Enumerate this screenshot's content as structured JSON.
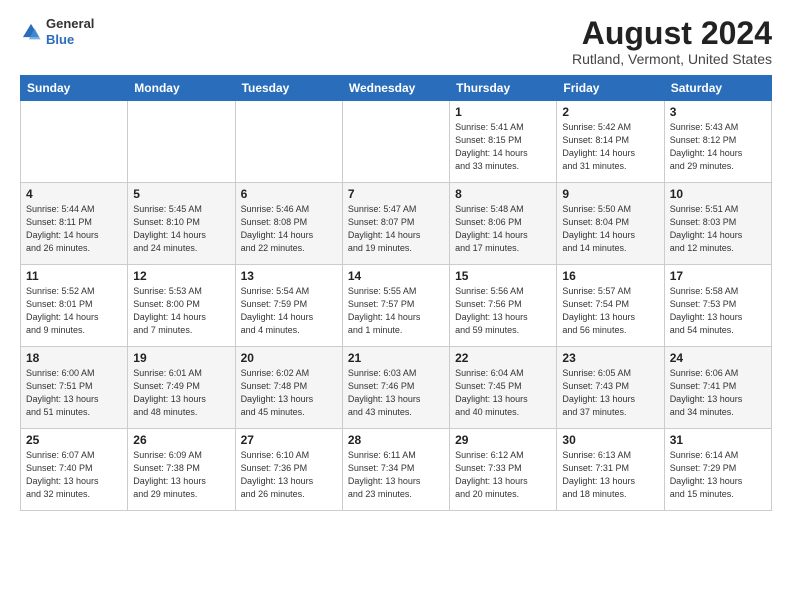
{
  "header": {
    "logo": {
      "general": "General",
      "blue": "Blue"
    },
    "title": "August 2024",
    "location": "Rutland, Vermont, United States"
  },
  "weekdays": [
    "Sunday",
    "Monday",
    "Tuesday",
    "Wednesday",
    "Thursday",
    "Friday",
    "Saturday"
  ],
  "weeks": [
    [
      {
        "day": "",
        "info": ""
      },
      {
        "day": "",
        "info": ""
      },
      {
        "day": "",
        "info": ""
      },
      {
        "day": "",
        "info": ""
      },
      {
        "day": "1",
        "info": "Sunrise: 5:41 AM\nSunset: 8:15 PM\nDaylight: 14 hours\nand 33 minutes."
      },
      {
        "day": "2",
        "info": "Sunrise: 5:42 AM\nSunset: 8:14 PM\nDaylight: 14 hours\nand 31 minutes."
      },
      {
        "day": "3",
        "info": "Sunrise: 5:43 AM\nSunset: 8:12 PM\nDaylight: 14 hours\nand 29 minutes."
      }
    ],
    [
      {
        "day": "4",
        "info": "Sunrise: 5:44 AM\nSunset: 8:11 PM\nDaylight: 14 hours\nand 26 minutes."
      },
      {
        "day": "5",
        "info": "Sunrise: 5:45 AM\nSunset: 8:10 PM\nDaylight: 14 hours\nand 24 minutes."
      },
      {
        "day": "6",
        "info": "Sunrise: 5:46 AM\nSunset: 8:08 PM\nDaylight: 14 hours\nand 22 minutes."
      },
      {
        "day": "7",
        "info": "Sunrise: 5:47 AM\nSunset: 8:07 PM\nDaylight: 14 hours\nand 19 minutes."
      },
      {
        "day": "8",
        "info": "Sunrise: 5:48 AM\nSunset: 8:06 PM\nDaylight: 14 hours\nand 17 minutes."
      },
      {
        "day": "9",
        "info": "Sunrise: 5:50 AM\nSunset: 8:04 PM\nDaylight: 14 hours\nand 14 minutes."
      },
      {
        "day": "10",
        "info": "Sunrise: 5:51 AM\nSunset: 8:03 PM\nDaylight: 14 hours\nand 12 minutes."
      }
    ],
    [
      {
        "day": "11",
        "info": "Sunrise: 5:52 AM\nSunset: 8:01 PM\nDaylight: 14 hours\nand 9 minutes."
      },
      {
        "day": "12",
        "info": "Sunrise: 5:53 AM\nSunset: 8:00 PM\nDaylight: 14 hours\nand 7 minutes."
      },
      {
        "day": "13",
        "info": "Sunrise: 5:54 AM\nSunset: 7:59 PM\nDaylight: 14 hours\nand 4 minutes."
      },
      {
        "day": "14",
        "info": "Sunrise: 5:55 AM\nSunset: 7:57 PM\nDaylight: 14 hours\nand 1 minute."
      },
      {
        "day": "15",
        "info": "Sunrise: 5:56 AM\nSunset: 7:56 PM\nDaylight: 13 hours\nand 59 minutes."
      },
      {
        "day": "16",
        "info": "Sunrise: 5:57 AM\nSunset: 7:54 PM\nDaylight: 13 hours\nand 56 minutes."
      },
      {
        "day": "17",
        "info": "Sunrise: 5:58 AM\nSunset: 7:53 PM\nDaylight: 13 hours\nand 54 minutes."
      }
    ],
    [
      {
        "day": "18",
        "info": "Sunrise: 6:00 AM\nSunset: 7:51 PM\nDaylight: 13 hours\nand 51 minutes."
      },
      {
        "day": "19",
        "info": "Sunrise: 6:01 AM\nSunset: 7:49 PM\nDaylight: 13 hours\nand 48 minutes."
      },
      {
        "day": "20",
        "info": "Sunrise: 6:02 AM\nSunset: 7:48 PM\nDaylight: 13 hours\nand 45 minutes."
      },
      {
        "day": "21",
        "info": "Sunrise: 6:03 AM\nSunset: 7:46 PM\nDaylight: 13 hours\nand 43 minutes."
      },
      {
        "day": "22",
        "info": "Sunrise: 6:04 AM\nSunset: 7:45 PM\nDaylight: 13 hours\nand 40 minutes."
      },
      {
        "day": "23",
        "info": "Sunrise: 6:05 AM\nSunset: 7:43 PM\nDaylight: 13 hours\nand 37 minutes."
      },
      {
        "day": "24",
        "info": "Sunrise: 6:06 AM\nSunset: 7:41 PM\nDaylight: 13 hours\nand 34 minutes."
      }
    ],
    [
      {
        "day": "25",
        "info": "Sunrise: 6:07 AM\nSunset: 7:40 PM\nDaylight: 13 hours\nand 32 minutes."
      },
      {
        "day": "26",
        "info": "Sunrise: 6:09 AM\nSunset: 7:38 PM\nDaylight: 13 hours\nand 29 minutes."
      },
      {
        "day": "27",
        "info": "Sunrise: 6:10 AM\nSunset: 7:36 PM\nDaylight: 13 hours\nand 26 minutes."
      },
      {
        "day": "28",
        "info": "Sunrise: 6:11 AM\nSunset: 7:34 PM\nDaylight: 13 hours\nand 23 minutes."
      },
      {
        "day": "29",
        "info": "Sunrise: 6:12 AM\nSunset: 7:33 PM\nDaylight: 13 hours\nand 20 minutes."
      },
      {
        "day": "30",
        "info": "Sunrise: 6:13 AM\nSunset: 7:31 PM\nDaylight: 13 hours\nand 18 minutes."
      },
      {
        "day": "31",
        "info": "Sunrise: 6:14 AM\nSunset: 7:29 PM\nDaylight: 13 hours\nand 15 minutes."
      }
    ]
  ]
}
